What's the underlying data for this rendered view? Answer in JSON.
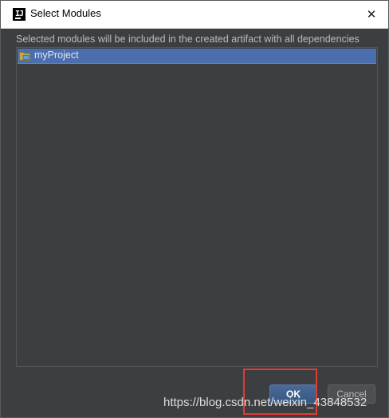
{
  "window": {
    "title": "Select Modules",
    "app_icon_text": "IJ",
    "close_glyph": "✕"
  },
  "description": "Selected modules will be included in the created artifact with all dependencies",
  "module_list": {
    "items": [
      {
        "label": "myProject",
        "icon": "module-folder-icon",
        "selected": true
      }
    ]
  },
  "buttons": {
    "ok_label": "OK",
    "cancel_label": "Cancel"
  },
  "watermark": "https://blog.csdn.net/weixin_43848532",
  "colors": {
    "background": "#3c3f41",
    "selection": "#4b6eaf",
    "highlight": "#e53935"
  }
}
